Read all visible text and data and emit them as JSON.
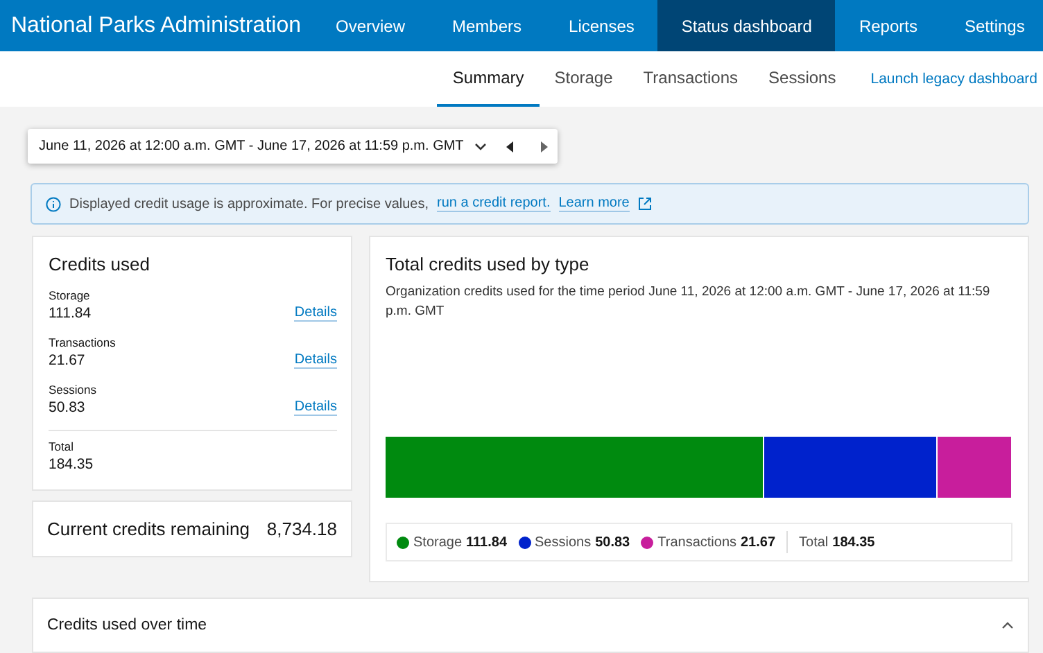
{
  "header": {
    "title": "National Parks Administration",
    "nav": [
      {
        "label": "Overview",
        "selected": false
      },
      {
        "label": "Members",
        "selected": false
      },
      {
        "label": "Licenses",
        "selected": false
      },
      {
        "label": "Status dashboard",
        "selected": true
      },
      {
        "label": "Reports",
        "selected": false
      },
      {
        "label": "Settings",
        "selected": false
      }
    ]
  },
  "subnav": {
    "tabs": [
      {
        "label": "Summary",
        "selected": true
      },
      {
        "label": "Storage",
        "selected": false
      },
      {
        "label": "Transactions",
        "selected": false
      },
      {
        "label": "Sessions",
        "selected": false
      }
    ],
    "link": "Launch legacy dashboard"
  },
  "date_range": {
    "value": "June 11, 2026 at 12:00 a.m. GMT - June 17, 2026 at 11:59 p.m. GMT"
  },
  "notice": {
    "text": "Displayed credit usage is approximate. For precise values,",
    "link": "run a credit report.",
    "learn_more": "Learn more"
  },
  "credits_used": {
    "title": "Credits used",
    "items": [
      {
        "label": "Storage",
        "value": "111.84",
        "link": "Details"
      },
      {
        "label": "Transactions",
        "value": "21.67",
        "link": "Details"
      },
      {
        "label": "Sessions",
        "value": "50.83",
        "link": "Details"
      }
    ],
    "total_label": "Total",
    "total_value": "184.35"
  },
  "remaining": {
    "label": "Current credits remaining",
    "value": "8,734.18"
  },
  "by_type": {
    "title": "Total credits used by type",
    "subtitle": "Organization credits used for the time period June 11, 2026 at 12:00 a.m. GMT - June 17, 2026 at 11:59 p.m. GMT",
    "legend": [
      {
        "label": "Storage",
        "value": "111.84",
        "color": "#008a0f"
      },
      {
        "label": "Sessions",
        "value": "50.83",
        "color": "#0022cc"
      },
      {
        "label": "Transactions",
        "value": "21.67",
        "color": "#c81e9c"
      }
    ],
    "total_label": "Total",
    "total_value": "184.35"
  },
  "over_time": {
    "title": "Credits used over time",
    "expanded": true
  }
}
